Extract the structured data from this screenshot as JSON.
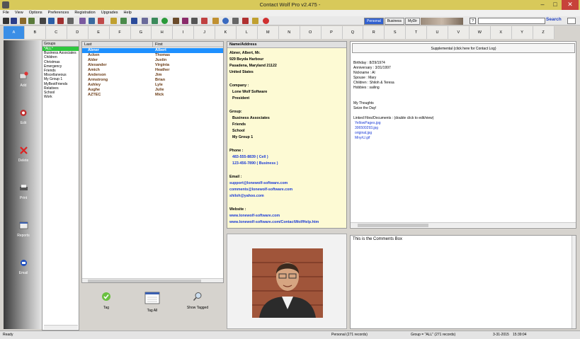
{
  "window": {
    "title": "Contact Wolf Pro v2.475 -",
    "minimize": "–",
    "maximize": "□",
    "close": "✕"
  },
  "menu": [
    "File",
    "View",
    "Options",
    "Preferences",
    "Registration",
    "Upgrades",
    "Help"
  ],
  "toolbar": {
    "filter_tabs": [
      {
        "label": "Personal",
        "active": true
      },
      {
        "label": "Business",
        "active": false
      },
      {
        "label": "MyDir",
        "active": false
      }
    ],
    "help_label": "?",
    "search_value": "",
    "search_label": "Search"
  },
  "alphabet": [
    "A",
    "B",
    "C",
    "D",
    "E",
    "F",
    "G",
    "H",
    "I",
    "J",
    "K",
    "L",
    "M",
    "N",
    "O",
    "P",
    "Q",
    "R",
    "S",
    "T",
    "U",
    "V",
    "W",
    "X",
    "Y",
    "Z"
  ],
  "alphabet_selected": "A",
  "sidebar": [
    {
      "label": "Add",
      "icon": "add-contact-icon"
    },
    {
      "label": "Edit",
      "icon": "edit-icon"
    },
    {
      "label": "Delete",
      "icon": "delete-icon"
    },
    {
      "label": "Print",
      "icon": "print-icon"
    },
    {
      "label": "Reports",
      "icon": "reports-icon"
    },
    {
      "label": "Email",
      "icon": "email-icon"
    }
  ],
  "groups": {
    "header": "Groups",
    "items": [
      "*ALL*",
      "Business Associates",
      "Children",
      "Christmas",
      "Emergency",
      "Friends",
      "Miscellaneous",
      "My Group 1",
      "MyBestFriends",
      "Relatives",
      "School",
      "Work"
    ],
    "selected": "*ALL*"
  },
  "contacts": {
    "col_last": "Last",
    "col_first": "First",
    "rows": [
      {
        "last": "Abner",
        "first": "Albert",
        "selected": true
      },
      {
        "last": "Acken",
        "first": "Thomas"
      },
      {
        "last": "Alder",
        "first": "Justin"
      },
      {
        "last": "Alexander",
        "first": "Virginia"
      },
      {
        "last": "Amich",
        "first": "Heather"
      },
      {
        "last": "Anderson",
        "first": "Jim"
      },
      {
        "last": "Armstrong",
        "first": "Brian"
      },
      {
        "last": "Ashley",
        "first": "Lyle"
      },
      {
        "last": "Aughe",
        "first": "Julie"
      },
      {
        "last": "AZTEC",
        "first": "Mick"
      }
    ]
  },
  "tag_buttons": [
    {
      "label": "Tag",
      "icon": "checkmark-icon"
    },
    {
      "label": "Tag All",
      "icon": "tag-all-icon"
    },
    {
      "label": "Show Tagged",
      "icon": "magnifier-icon"
    }
  ],
  "details": {
    "header": "Name/Address",
    "name": "Abner, Albert, Mr.",
    "street": "929 Beyda Harbour",
    "city_state_zip": "Pasadena, Maryland  21122",
    "country": "United States",
    "company_label": "Company :",
    "company": "Lone Wolf Software",
    "title": "President",
    "group_label": "Group:",
    "groups": [
      "Business Associates",
      "Friends",
      "School",
      "My Group 1"
    ],
    "phone_label": "Phone :",
    "phones": [
      "483-555-8839 ( Cell )",
      "123-456-7890 ( Business )"
    ],
    "email_label": "Email :",
    "emails": [
      "support@lonewolf-software.com",
      "comments@lonewolf-software.com",
      "shiloh@yahoo.com"
    ],
    "website_label": "Website :",
    "websites": [
      "www.lonewolf-software.com",
      "www.lonewolf-software.com/ContactWolfHelp.htm"
    ]
  },
  "supplemental": {
    "button": "Supplemental (click here for Contact Log)",
    "lines": [
      "Birthday :  8/29/1974",
      "Anniversary :  3/31/1997",
      "Nickname :  Al",
      "Spouse :  Mary",
      "Children :  Shiloh & Teresa",
      "Hobbies :  sailing"
    ],
    "thoughts_label": "My Thoughts",
    "thoughts": " Seize the Day!",
    "files_label": "Linked Files/Documents :  (double click to edit/view)",
    "files": [
      "YellowPages.jpg",
      "306500293.jpg",
      "original.jpg",
      "MnyrU.gif"
    ]
  },
  "comments": {
    "text": "This is the Comments Box"
  },
  "status": {
    "left": "Ready",
    "records": "Personal (271 records)",
    "group": "Group = \"ALL\" (271 records)",
    "date": "3-31-2015",
    "time": "15:39:04"
  }
}
